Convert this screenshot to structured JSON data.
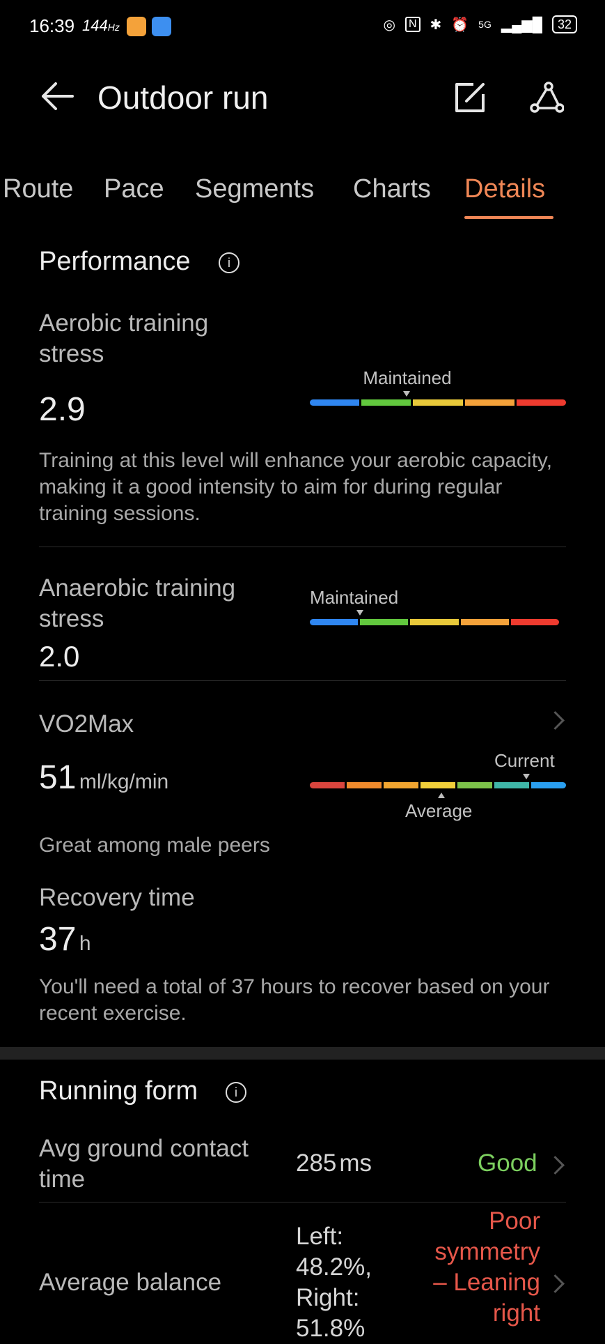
{
  "status_bar": {
    "time": "16:39",
    "refresh": "144",
    "refresh_unit": "Hz",
    "network": "5G",
    "battery": "32"
  },
  "header": {
    "title": "Outdoor run",
    "back_icon": "arrow-left",
    "edit_icon": "edit",
    "route_icon": "route"
  },
  "tabs": [
    {
      "label": "Route"
    },
    {
      "label": "Pace"
    },
    {
      "label": "Segments"
    },
    {
      "label": "Charts"
    },
    {
      "label": "Details"
    }
  ],
  "active_tab": "Details",
  "performance": {
    "title": "Performance",
    "aerobic": {
      "label": "Aerobic training stress",
      "value": "2.9",
      "level": "Maintained",
      "description": "Training at this level will enhance your aerobic capacity, making it a good intensity to aim for during regular training sessions."
    },
    "anaerobic": {
      "label": "Anaerobic training stress",
      "value": "2.0",
      "level": "Maintained"
    },
    "vo2max": {
      "label": "VO2Max",
      "value": "51",
      "unit": "ml/kg/min",
      "current_label": "Current",
      "average_label": "Average",
      "comment": "Great among male peers"
    },
    "recovery": {
      "label": "Recovery time",
      "value": "37",
      "unit": "h",
      "description": "You'll need a total of 37 hours to recover based on your recent exercise."
    }
  },
  "running_form": {
    "title": "Running form",
    "rows": [
      {
        "label": "Avg ground contact time",
        "value": "285",
        "unit": "ms",
        "rating": "Good"
      },
      {
        "label": "Average balance",
        "value": "Left: 48.2%, Right: 51.8%",
        "rating": "Poor symmetry – Leaning right"
      }
    ]
  },
  "colors": {
    "accent": "#f08756",
    "good": "#7ccf5f",
    "poor": "#e6574a",
    "stress_scale": [
      "#2f86f0",
      "#62c83e",
      "#e8c93a",
      "#f4a23a",
      "#ee3b2f"
    ],
    "vo2_scale": [
      "#d9453e",
      "#ef8a2c",
      "#f1a530",
      "#f0cf3a",
      "#7dc24a",
      "#3fb6a8",
      "#2a9ff0"
    ]
  }
}
